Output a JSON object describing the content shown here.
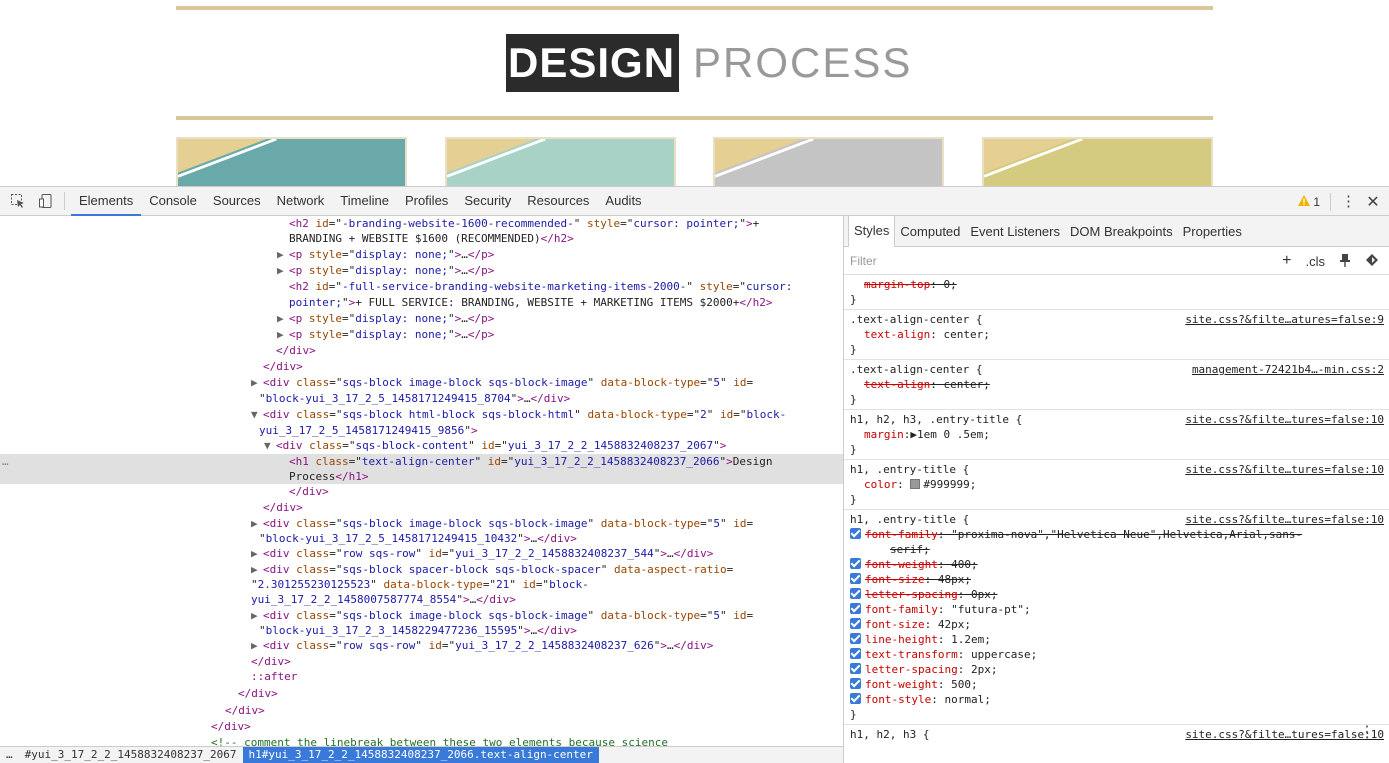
{
  "page": {
    "title_dark": "DESIGN",
    "title_light": "PROCESS",
    "colors": {
      "gold": "#d9c79a",
      "card1": "#6aa9a9",
      "card2": "#a9d2c6",
      "card3": "#c4c4c4",
      "card4": "#d5cb80"
    }
  },
  "toolbar": {
    "tabs": [
      "Elements",
      "Console",
      "Sources",
      "Network",
      "Timeline",
      "Profiles",
      "Security",
      "Resources",
      "Audits"
    ],
    "active_tab": "Elements",
    "warning_count": "1",
    "icons": [
      "inspect-icon",
      "device-mode-icon",
      "warning-icon",
      "more-vert-icon",
      "close-icon"
    ]
  },
  "elements": {
    "lines": [
      {
        "indent": 289,
        "html": "<span class='tag'>&lt;h2</span> <span class='attr'>id</span>=\"<span class='val'>-branding-website-1600-recommended-</span>\" <span class='attr'>style</span>=\"<span class='val'>cursor: pointer;</span>\"<span class='tag'>&gt;</span>+"
      },
      {
        "indent": 289,
        "html": "BRANDING + WEBSITE $1600 (RECOMMENDED)<span class='tag'>&lt;/h2&gt;</span>"
      },
      {
        "indent": 277,
        "html": "<span class='tri-ic'>▶</span><span class='tag'>&lt;p</span> <span class='attr'>style</span>=\"<span class='val'>display: none;</span>\"<span class='tag'>&gt;</span>…<span class='tag'>&lt;/p&gt;</span>"
      },
      {
        "indent": 277,
        "html": "<span class='tri-ic'>▶</span><span class='tag'>&lt;p</span> <span class='attr'>style</span>=\"<span class='val'>display: none;</span>\"<span class='tag'>&gt;</span>…<span class='tag'>&lt;/p&gt;</span>"
      },
      {
        "indent": 289,
        "html": "<span class='tag'>&lt;h2</span> <span class='attr'>id</span>=\"<span class='val'>-full-service-branding-website-marketing-items-2000-</span>\" <span class='attr'>style</span>=\"<span class='val'>cursor:</span>"
      },
      {
        "indent": 289,
        "html": "<span class='val'>pointer;</span>\"<span class='tag'>&gt;</span>+ FULL SERVICE: BRANDING, WEBSITE + MARKETING ITEMS $2000+<span class='tag'>&lt;/h2&gt;</span>"
      },
      {
        "indent": 277,
        "html": "<span class='tri-ic'>▶</span><span class='tag'>&lt;p</span> <span class='attr'>style</span>=\"<span class='val'>display: none;</span>\"<span class='tag'>&gt;</span>…<span class='tag'>&lt;/p&gt;</span>"
      },
      {
        "indent": 277,
        "html": "<span class='tri-ic'>▶</span><span class='tag'>&lt;p</span> <span class='attr'>style</span>=\"<span class='val'>display: none;</span>\"<span class='tag'>&gt;</span>…<span class='tag'>&lt;/p&gt;</span>"
      },
      {
        "indent": 276,
        "html": "<span class='tag'>&lt;/div&gt;</span>"
      },
      {
        "indent": 263,
        "html": "<span class='tag'>&lt;/div&gt;</span>"
      },
      {
        "indent": 251,
        "html": "<span class='tri-ic'>▶</span><span class='tag'>&lt;div</span> <span class='attr'>class</span>=\"<span class='val'>sqs-block image-block sqs-block-image</span>\" <span class='attr'>data-block-type</span>=\"<span class='val'>5</span>\" <span class='attr'>id</span>="
      },
      {
        "indent": 259,
        "html": "\"<span class='val'>block-yui_3_17_2_5_1458171249415_8704</span>\"<span class='tag'>&gt;</span>…<span class='tag'>&lt;/div&gt;</span>"
      },
      {
        "indent": 251,
        "html": "<span class='tri-ic'>▼</span><span class='tag'>&lt;div</span> <span class='attr'>class</span>=\"<span class='val'>sqs-block html-block sqs-block-html</span>\" <span class='attr'>data-block-type</span>=\"<span class='val'>2</span>\" <span class='attr'>id</span>=\"<span class='val'>block-</span>"
      },
      {
        "indent": 259,
        "html": "<span class='val'>yui_3_17_2_5_1458171249415_9856</span>\"<span class='tag'>&gt;</span>"
      },
      {
        "indent": 264,
        "html": "<span class='tri-ic'>▼</span><span class='tag'>&lt;div</span> <span class='attr'>class</span>=\"<span class='val'>sqs-block-content</span>\" <span class='attr'>id</span>=\"<span class='val'>yui_3_17_2_2_1458832408237_2067</span>\"<span class='tag'>&gt;</span>"
      },
      {
        "indent": 289,
        "sel": true,
        "html": "<span class='tag'>&lt;h1</span> <span class='attr'>class</span>=\"<span class='val'>text-align-center</span>\" <span class='attr'>id</span>=\"<span class='val'>yui_3_17_2_2_1458832408237_2066</span>\"<span class='tag'>&gt;</span>Design"
      },
      {
        "indent": 289,
        "sel": true,
        "html": "Process<span class='tag'>&lt;/h1&gt;</span>"
      },
      {
        "indent": 289,
        "html": "<span class='tag'>&lt;/div&gt;</span>"
      },
      {
        "indent": 263,
        "html": "<span class='tag'>&lt;/div&gt;</span>"
      },
      {
        "indent": 251,
        "html": "<span class='tri-ic'>▶</span><span class='tag'>&lt;div</span> <span class='attr'>class</span>=\"<span class='val'>sqs-block image-block sqs-block-image</span>\" <span class='attr'>data-block-type</span>=\"<span class='val'>5</span>\" <span class='attr'>id</span>="
      },
      {
        "indent": 259,
        "html": "\"<span class='val'>block-yui_3_17_2_5_1458171249415_10432</span>\"<span class='tag'>&gt;</span>…<span class='tag'>&lt;/div&gt;</span>"
      },
      {
        "indent": 251,
        "html": "<span class='tri-ic'>▶</span><span class='tag'>&lt;div</span> <span class='attr'>class</span>=\"<span class='val'>row sqs-row</span>\" <span class='attr'>id</span>=\"<span class='val'>yui_3_17_2_2_1458832408237_544</span>\"<span class='tag'>&gt;</span>…<span class='tag'>&lt;/div&gt;</span>"
      },
      {
        "indent": 251,
        "html": "<span class='tri-ic'>▶</span><span class='tag'>&lt;div</span> <span class='attr'>class</span>=\"<span class='val'>sqs-block spacer-block sqs-block-spacer</span>\" <span class='attr'>data-aspect-ratio</span>="
      },
      {
        "indent": 251,
        "html": "\"<span class='val'>2.301255230125523</span>\" <span class='attr'>data-block-type</span>=\"<span class='val'>21</span>\" <span class='attr'>id</span>=\"<span class='val'>block-</span>"
      },
      {
        "indent": 251,
        "html": "<span class='val'>yui_3_17_2_2_1458007587774_8554</span>\"<span class='tag'>&gt;</span>…<span class='tag'>&lt;/div&gt;</span>"
      },
      {
        "indent": 251,
        "html": "<span class='tri-ic'>▶</span><span class='tag'>&lt;div</span> <span class='attr'>class</span>=\"<span class='val'>sqs-block image-block sqs-block-image</span>\" <span class='attr'>data-block-type</span>=\"<span class='val'>5</span>\" <span class='attr'>id</span>="
      },
      {
        "indent": 259,
        "html": "\"<span class='val'>block-yui_3_17_2_3_1458229477236_15595</span>\"<span class='tag'>&gt;</span>…<span class='tag'>&lt;/div&gt;</span>"
      },
      {
        "indent": 251,
        "html": "<span class='tri-ic'>▶</span><span class='tag'>&lt;div</span> <span class='attr'>class</span>=\"<span class='val'>row sqs-row</span>\" <span class='attr'>id</span>=\"<span class='val'>yui_3_17_2_2_1458832408237_626</span>\"<span class='tag'>&gt;</span>…<span class='tag'>&lt;/div&gt;</span>"
      },
      {
        "indent": 251,
        "html": "<span class='tag'>&lt;/div&gt;</span>"
      },
      {
        "indent": 251,
        "html": "<span class='tag'>::after</span>"
      },
      {
        "indent": 238,
        "html": "<span class='tag'>&lt;/div&gt;</span>"
      },
      {
        "indent": 225,
        "html": "<span class='tag'>&lt;/div&gt;</span>"
      },
      {
        "indent": 211,
        "html": "<span class='tag'>&lt;/div&gt;</span>"
      },
      {
        "indent": 211,
        "html": "<span class='cmt'>&lt;!-- comment the linebreak between these two elements because science</span>"
      }
    ],
    "selected_marker": "…"
  },
  "breadcrumbs": [
    "…",
    "#yui_3_17_2_2_1458832408237_2067",
    "h1#yui_3_17_2_2_1458832408237_2066.text-align-center"
  ],
  "sidebar": {
    "tabs": [
      "Styles",
      "Computed",
      "Event Listeners",
      "DOM Breakpoints",
      "Properties"
    ],
    "active_tab": "Styles",
    "filter_placeholder": "Filter",
    "filter_tools": [
      "+",
      ".cls"
    ]
  }
}
